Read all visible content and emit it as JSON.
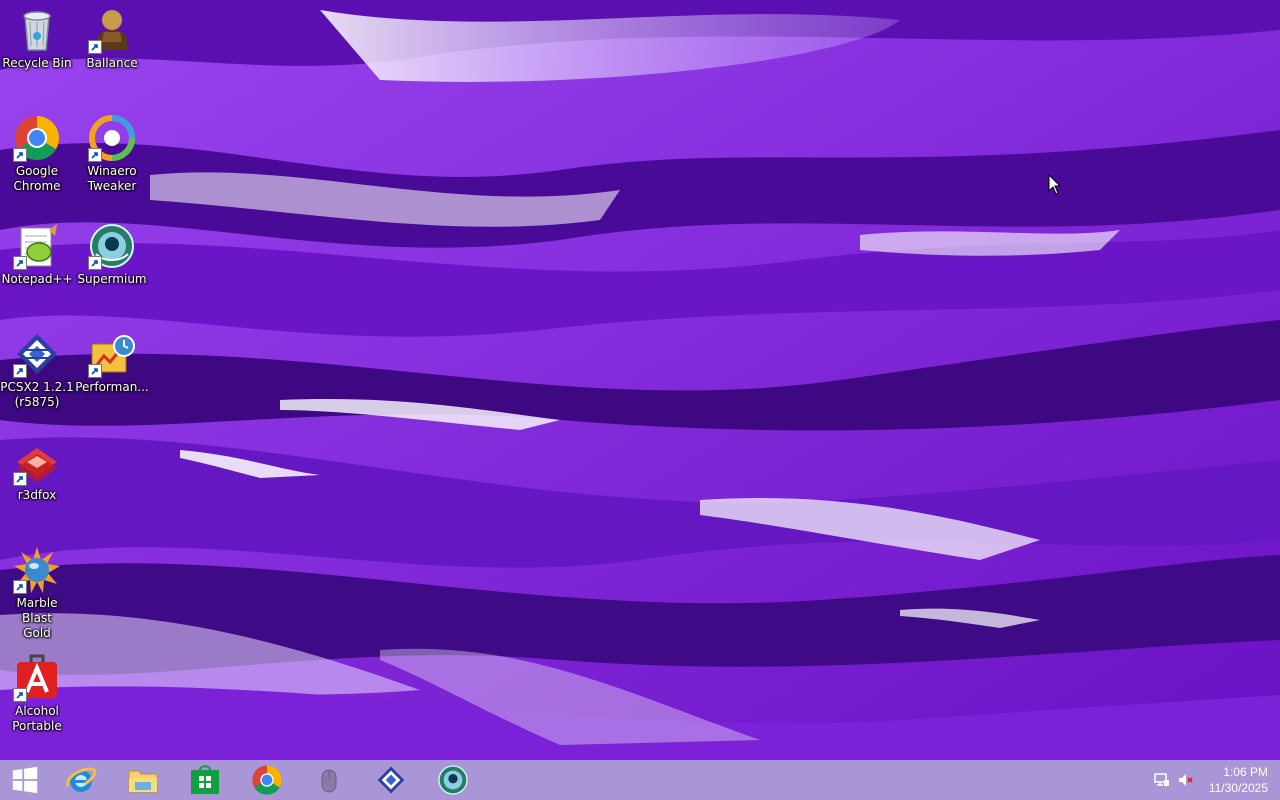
{
  "desktop": {
    "icons": [
      {
        "label": "Recycle Bin",
        "icon": "recycle-bin-icon",
        "shortcut": false
      },
      {
        "label": "Ballance",
        "icon": "ballance-icon",
        "shortcut": true
      },
      {
        "label": "Google\nChrome",
        "icon": "chrome-icon",
        "shortcut": true
      },
      {
        "label": "Winaero\nTweaker",
        "icon": "winaero-tweaker-icon",
        "shortcut": true
      },
      {
        "label": "Notepad++",
        "icon": "notepad-plus-plus-icon",
        "shortcut": true
      },
      {
        "label": "Supermium",
        "icon": "supermium-icon",
        "shortcut": true
      },
      {
        "label": "PCSX2 1.2.1\n(r5875)",
        "icon": "pcsx2-icon",
        "shortcut": true
      },
      {
        "label": "Performan...",
        "icon": "performance-icon",
        "shortcut": true
      },
      {
        "label": "r3dfox",
        "icon": "r3dfox-icon",
        "shortcut": true
      },
      {
        "label": "Marble Blast\nGold",
        "icon": "marble-blast-gold-icon",
        "shortcut": true
      },
      {
        "label": "Alcohol\nPortable",
        "icon": "alcohol-portable-icon",
        "shortcut": true
      }
    ]
  },
  "taskbar": {
    "buttons": [
      "start-button",
      "internet-explorer",
      "file-explorer",
      "store",
      "google-chrome",
      "mouse-app",
      "pcsx2",
      "supermium"
    ],
    "tray": {
      "icons": [
        "network-icon",
        "volume-muted-icon"
      ],
      "time": "1:06 PM",
      "date": "11/30/2025"
    }
  },
  "colors": {
    "wallpaper_base": "#7a1fd6",
    "wallpaper_dark": "#3c0a7a",
    "wallpaper_light": "#e8d8ff",
    "taskbar": "#a996d6"
  }
}
